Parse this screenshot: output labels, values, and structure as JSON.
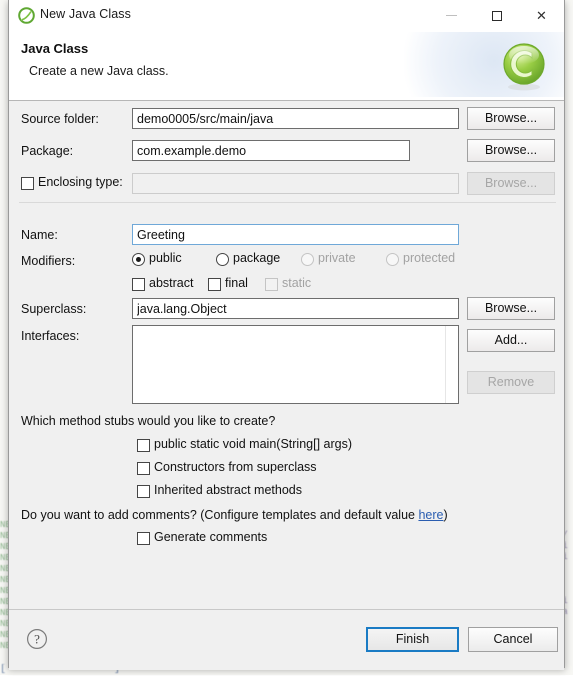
{
  "window": {
    "title": "New Java Class",
    "app_icon": "eclipse-icon",
    "minimize_label": "Minimize",
    "maximize_label": "Maximize",
    "close_label": "Close"
  },
  "header": {
    "title": "Java Class",
    "subtitle": "Create a new Java class.",
    "logo": "eclipse-logo"
  },
  "form": {
    "source_folder": {
      "label": "Source folder:",
      "value": "demo0005/src/main/java",
      "placeholder": "",
      "browse_label": "Browse..."
    },
    "package": {
      "label": "Package:",
      "value": "com.example.demo",
      "placeholder": "",
      "browse_label": "Browse..."
    },
    "enclosing_type": {
      "label": "Enclosing type:",
      "checked": false,
      "value": "",
      "placeholder": "",
      "browse_label": "Browse...",
      "disabled": true
    },
    "name": {
      "label": "Name:",
      "value": "Greeting",
      "placeholder": "",
      "focused": true
    },
    "modifiers": {
      "label": "Modifiers:",
      "radios": [
        {
          "label": "public",
          "checked": true,
          "disabled": false
        },
        {
          "label": "package",
          "checked": false,
          "disabled": false
        },
        {
          "label": "private",
          "checked": false,
          "disabled": true
        },
        {
          "label": "protected",
          "checked": false,
          "disabled": true
        }
      ],
      "checkboxes": [
        {
          "label": "abstract",
          "checked": false,
          "disabled": false
        },
        {
          "label": "final",
          "checked": false,
          "disabled": false
        },
        {
          "label": "static",
          "checked": false,
          "disabled": true
        }
      ]
    },
    "superclass": {
      "label": "Superclass:",
      "value": "java.lang.Object",
      "placeholder": "",
      "browse_label": "Browse..."
    },
    "interfaces": {
      "label": "Interfaces:",
      "items": [],
      "add_label": "Add...",
      "remove_label": "Remove",
      "remove_disabled": true
    }
  },
  "stubs": {
    "question": "Which method stubs would you like to create?",
    "options": [
      {
        "label": "public static void main(String[] args)",
        "checked": false
      },
      {
        "label": "Constructors from superclass",
        "checked": false
      },
      {
        "label": "Inherited abstract methods",
        "checked": false
      }
    ]
  },
  "comments": {
    "question_prefix": "Do you want to add comments? (Configure templates and default value ",
    "link_text": "here",
    "question_suffix": ")",
    "generate_label": "Generate comments",
    "generate_checked": false
  },
  "footer": {
    "help_icon": "help-question-icon",
    "finish_label": "Finish",
    "cancel_label": "Cancel"
  },
  "annotation": {
    "type": "red-underline-stroke",
    "color": "#f2222a"
  },
  "background": {
    "code_left": "NE\nNE\nNE\nNE\nNE\nNE\nNE\nNE\nNE\nNE\nNE\nNE",
    "code_right": "V/\nLi\nLi\n\nB\nE\nLi\nDa\n\n*",
    "code_bottom": "[                  ]                                                "
  },
  "colors": {
    "accent": "#1a7bc4",
    "annotation_red": "#f2222a",
    "link": "#2a5db0",
    "dialog_bg": "#f0f0f0",
    "logo_green": "#8cc63f"
  }
}
